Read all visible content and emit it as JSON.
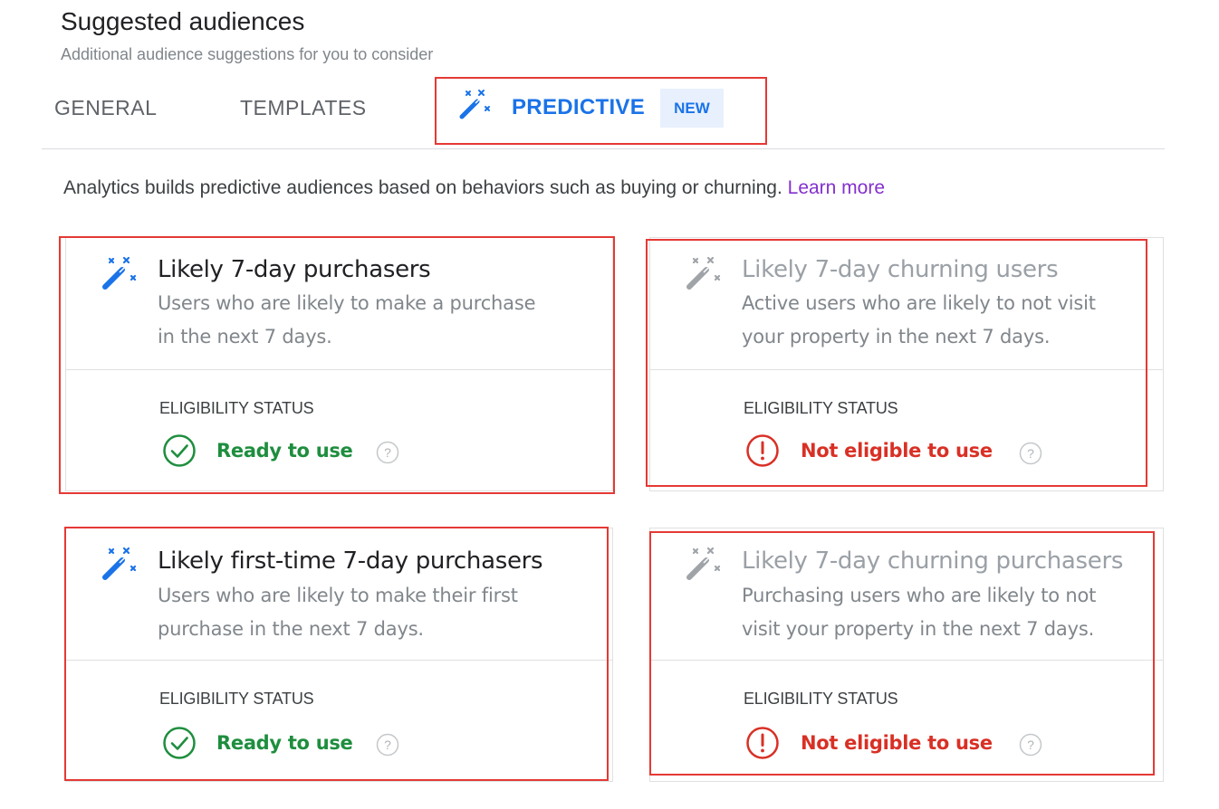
{
  "header": {
    "title": "Suggested audiences",
    "subtitle": "Additional audience suggestions for you to consider"
  },
  "tabs": [
    {
      "label": "GENERAL"
    },
    {
      "label": "TEMPLATES"
    },
    {
      "label": "PREDICTIVE",
      "badge": "NEW",
      "icon": "magic-wand-icon",
      "selected": true
    }
  ],
  "intro": {
    "text": "Analytics builds predictive audiences based on behaviors such as buying or churning. ",
    "link": "Learn more"
  },
  "cards": [
    {
      "title": "Likely 7-day purchasers",
      "desc_line1": "Users who are likely to make a purchase",
      "desc_line2": "in the next 7 days.",
      "eligibility_label": "ELIGIBILITY STATUS",
      "status": "Ready to use",
      "status_type": "ready",
      "enabled": true
    },
    {
      "title": "Likely 7-day churning users",
      "desc_line1": "Active users who are likely to not visit",
      "desc_line2": "your property in the next 7 days.",
      "eligibility_label": "ELIGIBILITY STATUS",
      "status": "Not eligible to use",
      "status_type": "not-eligible",
      "enabled": false
    },
    {
      "title": "Likely first-time 7-day purchasers",
      "desc_line1": "Users who are likely to make their first",
      "desc_line2": "purchase in the next 7 days.",
      "eligibility_label": "ELIGIBILITY STATUS",
      "status": "Ready to use",
      "status_type": "ready",
      "enabled": true
    },
    {
      "title": "Likely 7-day churning purchasers",
      "desc_line1": "Purchasing users who are likely to not",
      "desc_line2": "visit your property in the next 7 days.",
      "eligibility_label": "ELIGIBILITY STATUS",
      "status": "Not eligible to use",
      "status_type": "not-eligible",
      "enabled": false
    }
  ],
  "colors": {
    "accent": "#1a73e8",
    "ready": "#1e8e3e",
    "not_eligible": "#d93025",
    "highlight": "#e53935",
    "link": "#8430ce"
  }
}
